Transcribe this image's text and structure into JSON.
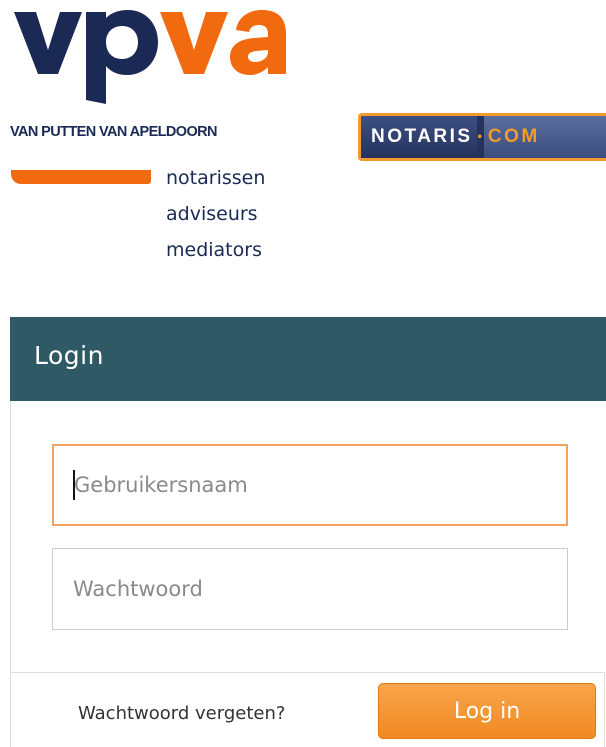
{
  "branding": {
    "logo_text": "vpva",
    "firm_name": "VAN PUTTEN VAN APELDOORN",
    "taglines": [
      "notarissen",
      "adviseurs",
      "mediators"
    ],
    "partner_badge": {
      "left": "NOTARIS",
      "separator": "·",
      "right": "COM"
    },
    "colors": {
      "navy": "#1b2a55",
      "orange": "#f26a10"
    }
  },
  "login": {
    "title": "Login",
    "header_color": "#2f5964",
    "username": {
      "placeholder": "Gebruikersnaam",
      "value": ""
    },
    "password": {
      "placeholder": "Wachtwoord",
      "value": ""
    },
    "forgot_link": "Wachtwoord vergeten?",
    "submit_label": "Log in",
    "button_color": "#f59830"
  }
}
